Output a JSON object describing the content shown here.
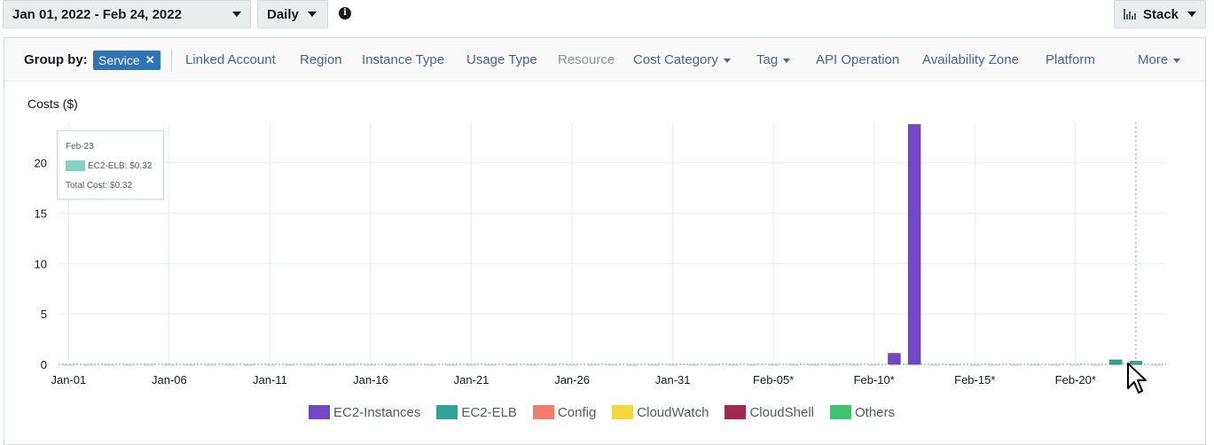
{
  "toolbar": {
    "date_range": "Jan 01, 2022 - Feb 24, 2022",
    "granularity": "Daily",
    "info_glyph": "i",
    "chart_style": "Stack"
  },
  "group_by": {
    "label": "Group by:",
    "selected_chip": "Service",
    "chip_close": "✕",
    "options": [
      {
        "label": "Linked Account",
        "has_caret": false,
        "disabled": false
      },
      {
        "label": "Region",
        "has_caret": false,
        "disabled": false
      },
      {
        "label": "Instance Type",
        "has_caret": false,
        "disabled": false
      },
      {
        "label": "Usage Type",
        "has_caret": false,
        "disabled": false
      },
      {
        "label": "Resource",
        "has_caret": false,
        "disabled": true
      },
      {
        "label": "Cost Category",
        "has_caret": true,
        "disabled": false
      },
      {
        "label": "Tag",
        "has_caret": true,
        "disabled": false
      },
      {
        "label": "API Operation",
        "has_caret": false,
        "disabled": false
      },
      {
        "label": "Availability Zone",
        "has_caret": false,
        "disabled": false
      },
      {
        "label": "Platform",
        "has_caret": false,
        "disabled": false
      },
      {
        "label": "More",
        "has_caret": true,
        "disabled": false
      }
    ]
  },
  "tooltip": {
    "date": "Feb-23",
    "series_label": "EC2-ELB: $0.32",
    "total": "Total Cost: $0.32"
  },
  "chart_data": {
    "type": "bar",
    "stacked": true,
    "ylabel": "Costs ($)",
    "ylim": [
      0,
      24
    ],
    "yticks": [
      0,
      5,
      10,
      15,
      20
    ],
    "grid": true,
    "legend_position": "bottom",
    "x_tick_labels": [
      "Jan-01",
      "Jan-06",
      "Jan-11",
      "Jan-16",
      "Jan-21",
      "Jan-26",
      "Jan-31",
      "Feb-05*",
      "Feb-10*",
      "Feb-15*",
      "Feb-20*"
    ],
    "x_tick_days": [
      0,
      5,
      10,
      15,
      20,
      25,
      30,
      35,
      40,
      45,
      50
    ],
    "num_days": 55,
    "series": [
      {
        "name": "EC2-Instances",
        "color": "#7248c6",
        "points": [
          {
            "day": 41,
            "value": 1.1
          },
          {
            "day": 42,
            "value": 23.8
          }
        ]
      },
      {
        "name": "EC2-ELB",
        "color": "#2ea597",
        "points": [
          {
            "day": 52,
            "value": 0.45
          },
          {
            "day": 53,
            "value": 0.32
          }
        ]
      },
      {
        "name": "Config",
        "color": "#f27c6d",
        "points": []
      },
      {
        "name": "CloudWatch",
        "color": "#f5d63d",
        "points": []
      },
      {
        "name": "CloudShell",
        "color": "#a4284e",
        "points": []
      },
      {
        "name": "Others",
        "color": "#3ec36e",
        "points": []
      }
    ],
    "hover_day": 53
  },
  "icons": {
    "date_dropdown": "caret-down-icon",
    "info": "info-icon",
    "stack": "bar-chart-icon",
    "cursor": "mouse-pointer-icon"
  }
}
